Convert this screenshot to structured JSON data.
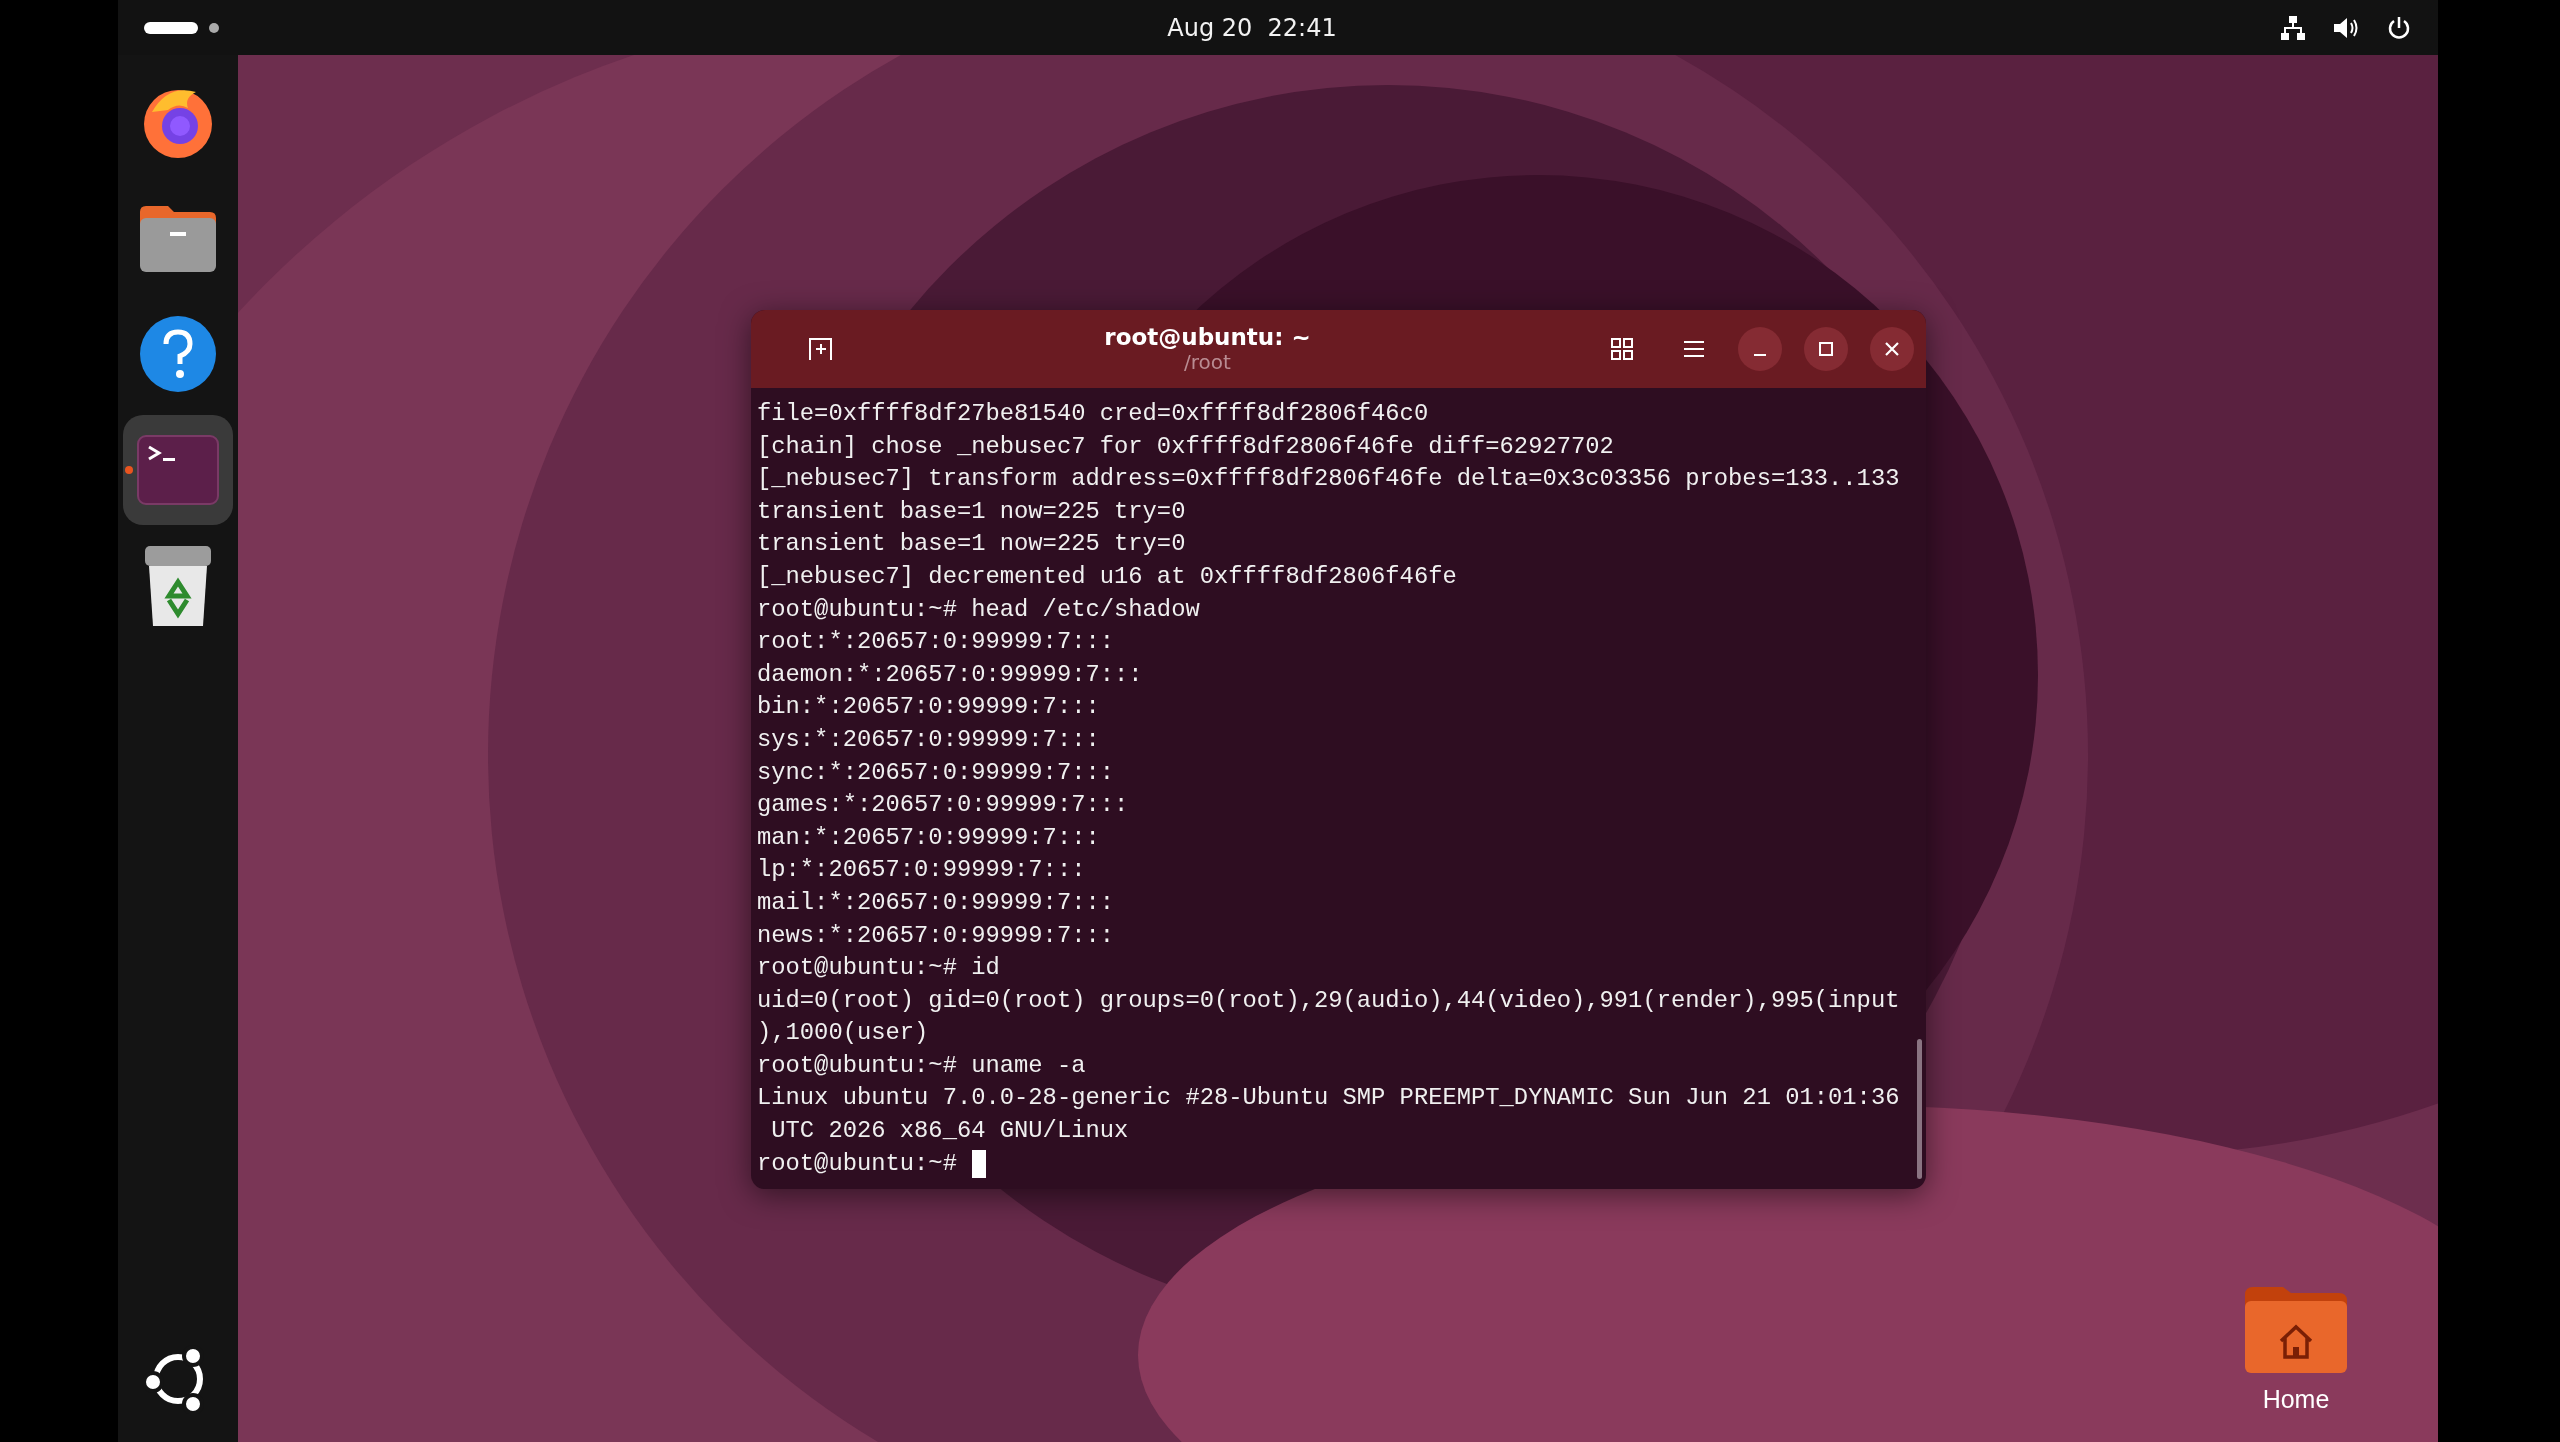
{
  "top_bar": {
    "clock": "Aug 20  22:41"
  },
  "dock": {
    "items": [
      {
        "kind": "browser",
        "active": false
      },
      {
        "kind": "files",
        "active": false
      },
      {
        "kind": "help",
        "active": false
      },
      {
        "kind": "terminal",
        "active": true
      },
      {
        "kind": "trash",
        "active": false
      }
    ]
  },
  "terminal": {
    "title": "root@ubuntu: ~",
    "subtitle": "/root",
    "lines": [
      "file=0xffff8df27be81540 cred=0xffff8df2806f46c0",
      "[chain] chose _nebusec7 for 0xffff8df2806f46fe diff=62927702",
      "[_nebusec7] transform address=0xffff8df2806f46fe delta=0x3c03356 probes=133..133",
      "transient base=1 now=225 try=0",
      "transient base=1 now=225 try=0",
      "[_nebusec7] decremented u16 at 0xffff8df2806f46fe",
      "root@ubuntu:~# head /etc/shadow",
      "root:*:20657:0:99999:7:::",
      "daemon:*:20657:0:99999:7:::",
      "bin:*:20657:0:99999:7:::",
      "sys:*:20657:0:99999:7:::",
      "sync:*:20657:0:99999:7:::",
      "games:*:20657:0:99999:7:::",
      "man:*:20657:0:99999:7:::",
      "lp:*:20657:0:99999:7:::",
      "mail:*:20657:0:99999:7:::",
      "news:*:20657:0:99999:7:::",
      "root@ubuntu:~# id",
      "uid=0(root) gid=0(root) groups=0(root),29(audio),44(video),991(render),995(input",
      "),1000(user)",
      "root@ubuntu:~# uname -a",
      "Linux ubuntu 7.0.0-28-generic #28-Ubuntu SMP PREEMPT_DYNAMIC Sun Jun 21 01:01:36",
      " UTC 2026 x86_64 GNU/Linux"
    ],
    "prompt": "root@ubuntu:~#"
  },
  "desktop": {
    "icons": [
      {
        "label": "Home"
      }
    ]
  }
}
